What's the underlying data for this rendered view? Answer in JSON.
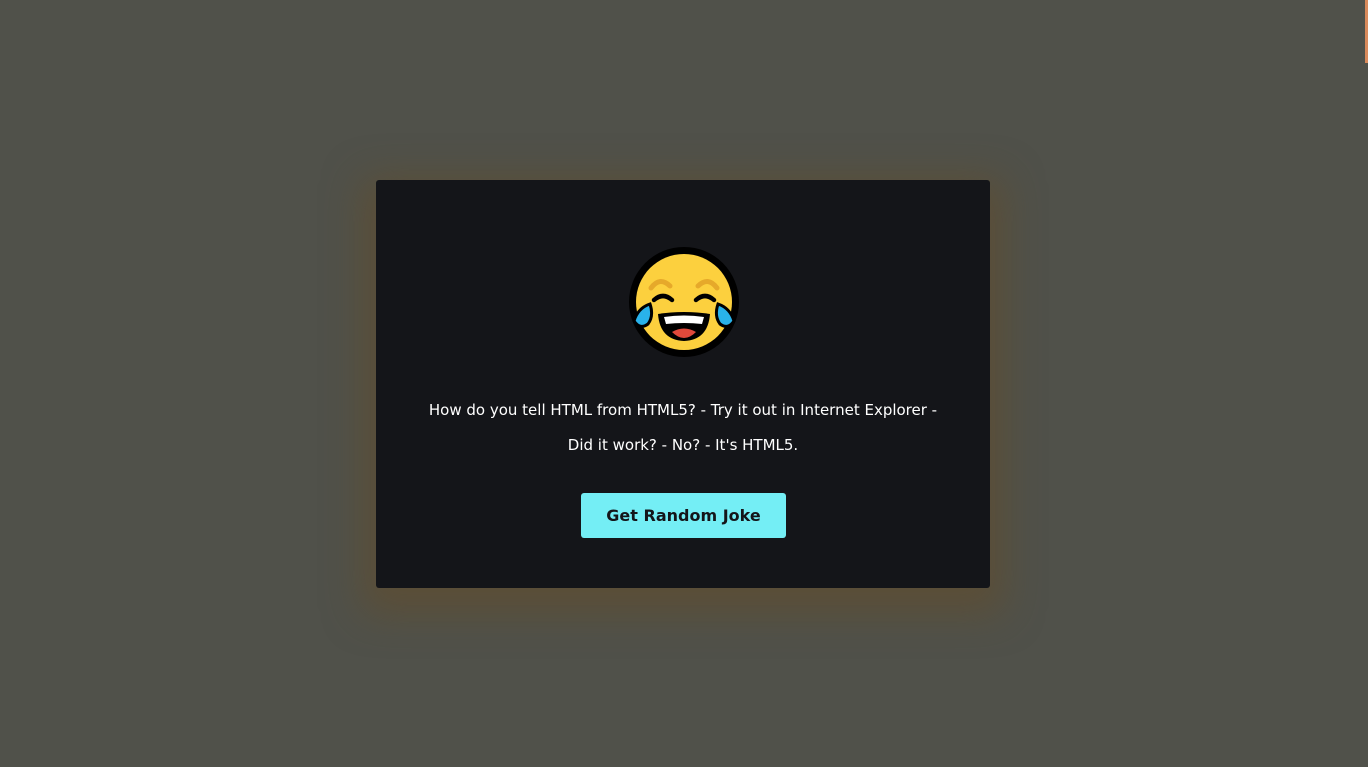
{
  "card": {
    "icon": "face-with-tears-of-joy-icon",
    "joke": "How do you tell HTML from HTML5? - Try it out in Internet Explorer - Did it work? - No? - It's HTML5.",
    "button_label": "Get Random Joke"
  },
  "colors": {
    "background": "#50514a",
    "card": "#141519",
    "button": "#74eef5",
    "text": "#ffffff",
    "edge_accent": "#d98a5b"
  }
}
